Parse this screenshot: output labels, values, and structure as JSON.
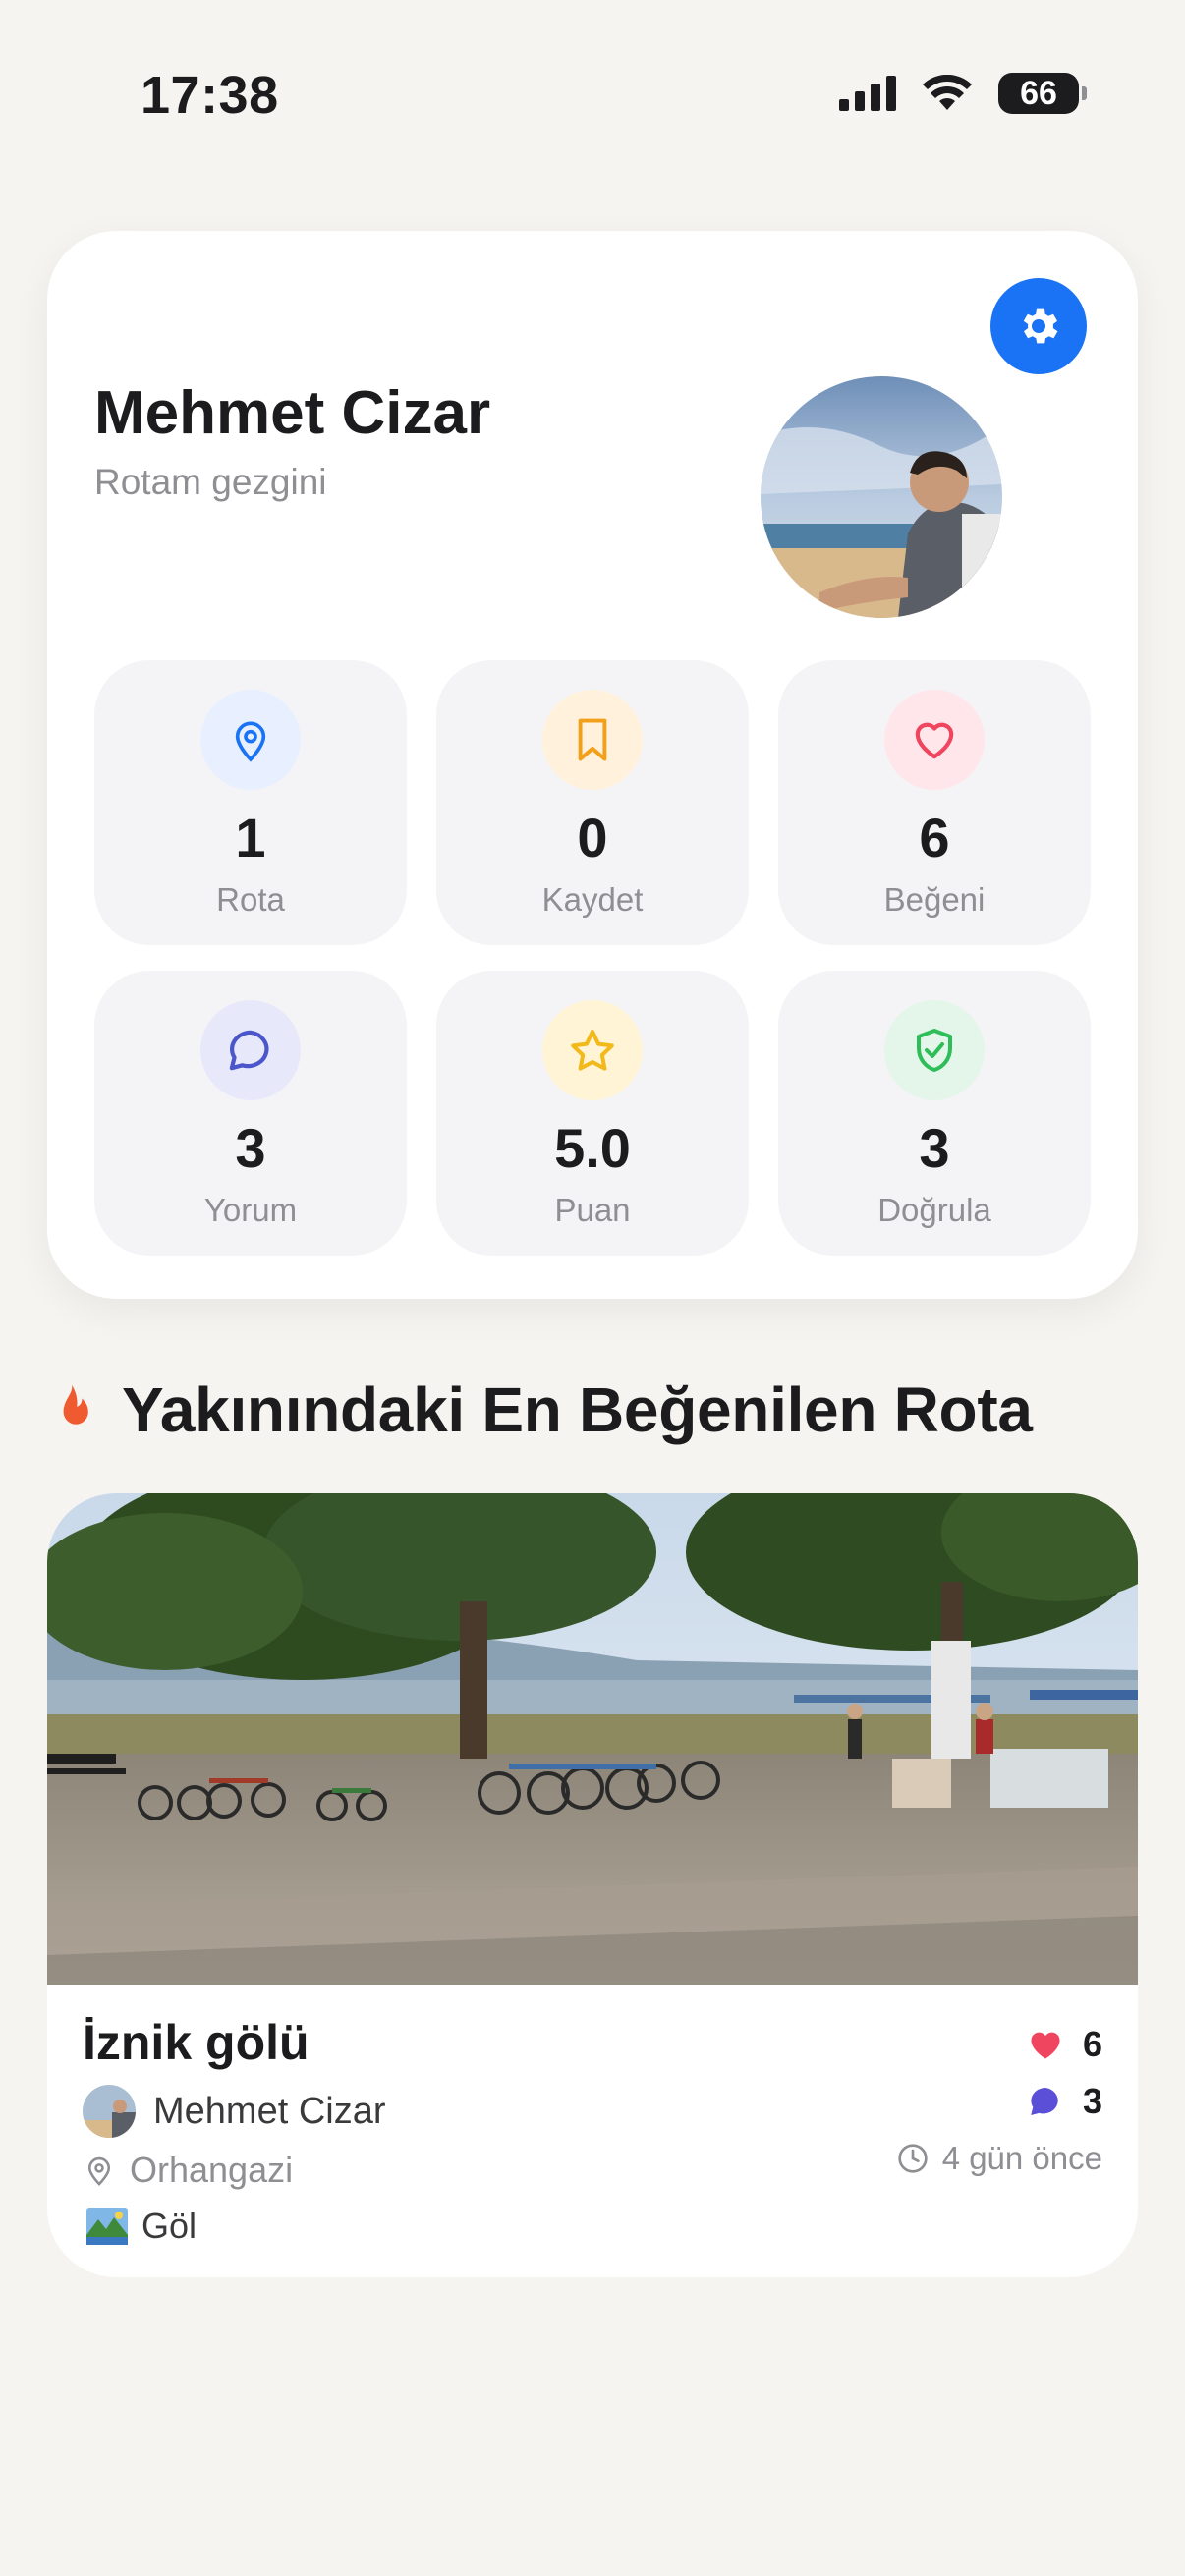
{
  "status_bar": {
    "time": "17:38",
    "battery": "66"
  },
  "profile": {
    "name": "Mehmet Cizar",
    "subtitle": "Rotam gezgini"
  },
  "stats": [
    {
      "value": "1",
      "label": "Rota",
      "icon": "map-pin-icon",
      "color": "#1a73f5",
      "bg": "#e8efff"
    },
    {
      "value": "0",
      "label": "Kaydet",
      "icon": "bookmark-icon",
      "color": "#f2a01a",
      "bg": "#fff1dc"
    },
    {
      "value": "6",
      "label": "Beğeni",
      "icon": "heart-icon",
      "color": "#f0455f",
      "bg": "#ffe6ea"
    },
    {
      "value": "3",
      "label": "Yorum",
      "icon": "comment-icon",
      "color": "#4a56c9",
      "bg": "#e7e9fb"
    },
    {
      "value": "5.0",
      "label": "Puan",
      "icon": "star-icon",
      "color": "#f2b91a",
      "bg": "#fff4d6"
    },
    {
      "value": "3",
      "label": "Doğrula",
      "icon": "shield-check-icon",
      "color": "#2ebd59",
      "bg": "#e3f6e9"
    }
  ],
  "section": {
    "title": "Yakınındaki En Beğenilen Rota",
    "icon": "fire-icon"
  },
  "route": {
    "title": "İznik gölü",
    "author": "Mehmet Cizar",
    "location": "Orhangazi",
    "category": "Göl",
    "likes": "6",
    "comments": "3",
    "time_ago": "4 gün önce"
  },
  "colors": {
    "accent": "#1a73f5",
    "like": "#f0455f",
    "comment": "#5a4fd6",
    "background": "#f6f4f0"
  }
}
